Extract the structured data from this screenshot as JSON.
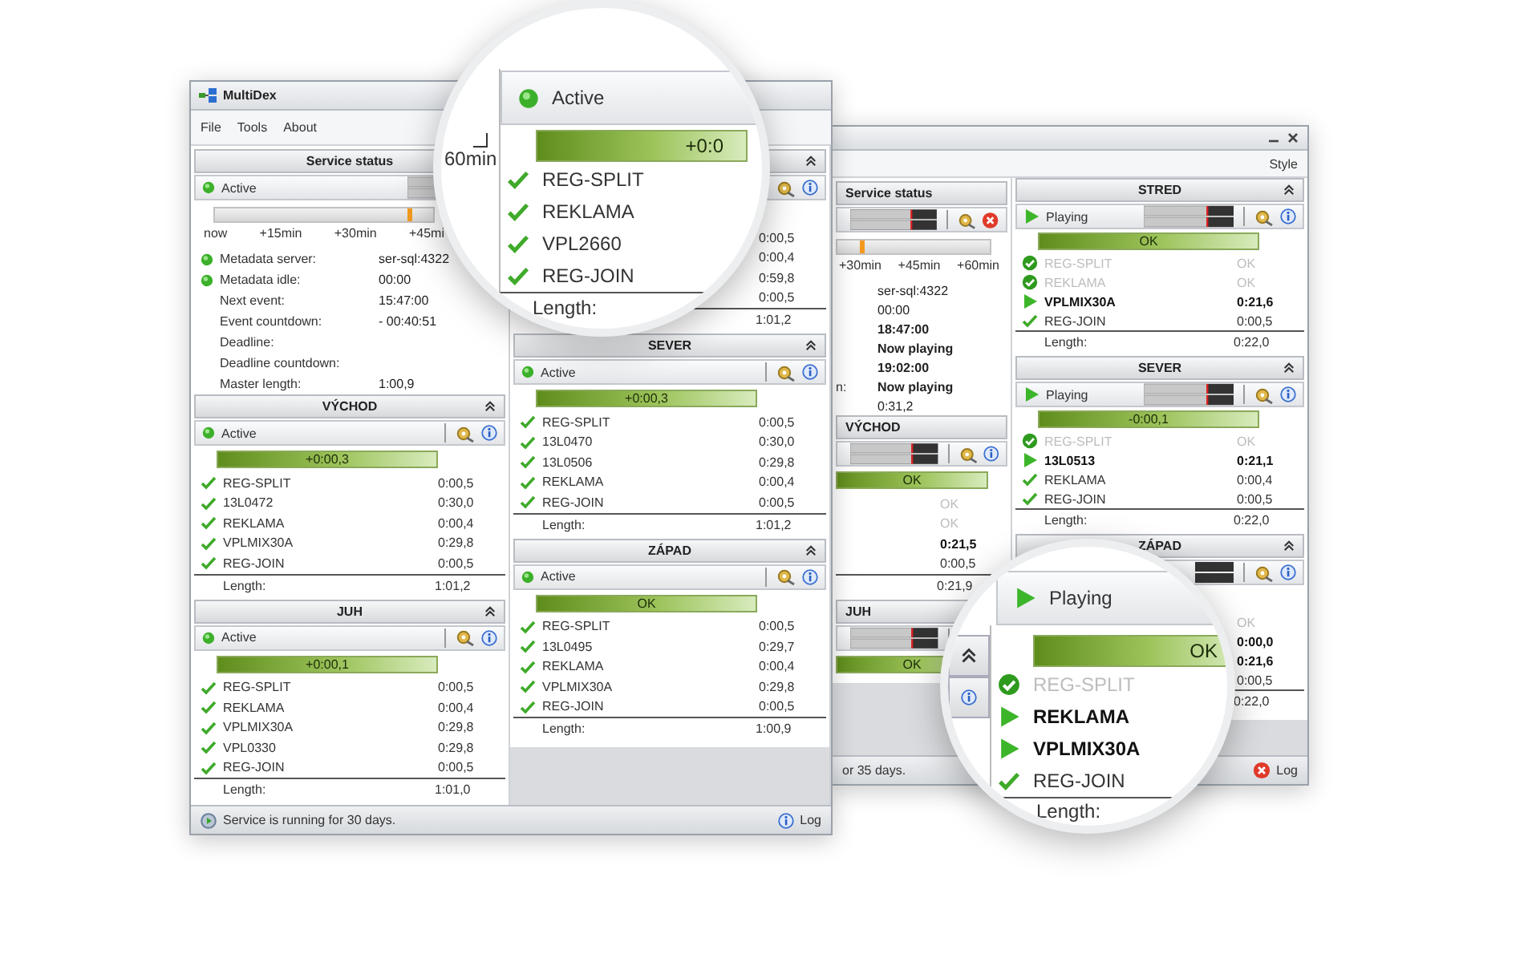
{
  "front_window": {
    "title": "MultiDex",
    "menu": [
      "File",
      "Tools",
      "About"
    ],
    "service": {
      "header": "Service status",
      "status": "Active",
      "kind": "active",
      "timeline": [
        "now",
        "+15min",
        "+30min",
        "+45mi"
      ],
      "info": [
        {
          "label": "Metadata server:",
          "value": "ser-sql:4322",
          "dot": true
        },
        {
          "label": "Metadata idle:",
          "value": "00:00",
          "dot": true
        },
        {
          "label": "Next event:",
          "value": "15:47:00",
          "dot": false
        },
        {
          "label": "Event countdown:",
          "value": "- 00:40:51",
          "dot": false
        },
        {
          "label": "Deadline:",
          "dot": false
        },
        {
          "label": "Deadline countdown:",
          "dot": false
        },
        {
          "label": "Master length:",
          "value": "1:00,9",
          "dot": false
        }
      ]
    },
    "left_groups": [
      {
        "title": "VÝCHOD",
        "status": "Active",
        "kind": "active",
        "offset": "+0:00,3",
        "rows": [
          {
            "name": "REG-SPLIT",
            "time": "0:00,5",
            "kind": "check"
          },
          {
            "name": "13L0472",
            "time": "0:30,0",
            "kind": "check"
          },
          {
            "name": "REKLAMA",
            "time": "0:00,4",
            "kind": "check"
          },
          {
            "name": "VPLMIX30A",
            "time": "0:29,8",
            "kind": "check"
          },
          {
            "name": "REG-JOIN",
            "time": "0:00,5",
            "kind": "check"
          }
        ],
        "length_label": "Length:",
        "length": "1:01,2"
      },
      {
        "title": "JUH",
        "status": "Active",
        "kind": "active",
        "offset": "+0:00,1",
        "rows": [
          {
            "name": "REG-SPLIT",
            "time": "0:00,5",
            "kind": "check"
          },
          {
            "name": "REKLAMA",
            "time": "0:00,4",
            "kind": "check"
          },
          {
            "name": "VPLMIX30A",
            "time": "0:29,8",
            "kind": "check"
          },
          {
            "name": "VPL0330",
            "time": "0:29,8",
            "kind": "check"
          },
          {
            "name": "REG-JOIN",
            "time": "0:00,5",
            "kind": "check"
          }
        ],
        "length_label": "Length:",
        "length": "1:01,0"
      }
    ],
    "right_groups": [
      {
        "rows": [
          {
            "time": "0:00,5",
            "kind": "check"
          },
          {
            "time": "0:00,4",
            "kind": "check"
          },
          {
            "time": "0:59,8",
            "kind": "check"
          },
          {
            "time": "0:00,5",
            "kind": "check"
          }
        ],
        "length": "1:01,2"
      },
      {
        "title": "SEVER",
        "status": "Active",
        "kind": "active",
        "offset": "+0:00,3",
        "rows": [
          {
            "name": "REG-SPLIT",
            "time": "0:00,5",
            "kind": "check"
          },
          {
            "name": "13L0470",
            "time": "0:30,0",
            "kind": "check"
          },
          {
            "name": "13L0506",
            "time": "0:29,8",
            "kind": "check"
          },
          {
            "name": "REKLAMA",
            "time": "0:00,4",
            "kind": "check"
          },
          {
            "name": "REG-JOIN",
            "time": "0:00,5",
            "kind": "check"
          }
        ],
        "length_label": "Length:",
        "length": "1:01,2"
      },
      {
        "title": "ZÁPAD",
        "status": "Active",
        "kind": "active",
        "offset": "OK",
        "rows": [
          {
            "name": "REG-SPLIT",
            "time": "0:00,5",
            "kind": "check"
          },
          {
            "name": "13L0495",
            "time": "0:29,7",
            "kind": "check"
          },
          {
            "name": "REKLAMA",
            "time": "0:00,4",
            "kind": "check"
          },
          {
            "name": "VPLMIX30A",
            "time": "0:29,8",
            "kind": "check"
          },
          {
            "name": "REG-JOIN",
            "time": "0:00,5",
            "kind": "check"
          }
        ],
        "length_label": "Length:",
        "length": "1:00,9"
      }
    ],
    "status_bar": {
      "text": "Service is running for 30 days.",
      "log": "Log"
    }
  },
  "back_window": {
    "menu": [
      "Style"
    ],
    "service": {
      "header": "Service status",
      "timeline": [
        "+30min",
        "+45min",
        "+60min"
      ],
      "info": [
        {
          "value": "ser-sql:4322",
          "bold": false
        },
        {
          "value": "00:00",
          "bold": false
        },
        {
          "value": "18:47:00",
          "bold": true
        },
        {
          "value": "Now playing",
          "bold": true
        },
        {
          "value": "19:02:00",
          "bold": true
        },
        {
          "label": "n:",
          "value": "Now playing",
          "bold": true
        },
        {
          "value": "0:31,2",
          "bold": false
        }
      ]
    },
    "left_groups": [
      {
        "title": "VÝCHOD",
        "offset": "OK",
        "rows": [
          {
            "time": "OK",
            "kind": "done"
          },
          {
            "time": "OK",
            "kind": "done"
          },
          {
            "time": "0:21,5",
            "kind": "playing"
          },
          {
            "time": "0:00,5",
            "kind": "check"
          }
        ],
        "length": "0:21,9"
      },
      {
        "title": "JUH",
        "offset": "OK"
      }
    ],
    "right_groups": [
      {
        "title": "STRED",
        "status": "Playing",
        "kind": "playing",
        "offset": "OK",
        "rows": [
          {
            "name": "REG-SPLIT",
            "time": "OK",
            "kind": "done"
          },
          {
            "name": "REKLAMA",
            "time": "OK",
            "kind": "done"
          },
          {
            "name": "VPLMIX30A",
            "time": "0:21,6",
            "kind": "playing"
          },
          {
            "name": "REG-JOIN",
            "time": "0:00,5",
            "kind": "check"
          }
        ],
        "length_label": "Length:",
        "length": "0:22,0"
      },
      {
        "title": "SEVER",
        "status": "Playing",
        "kind": "playing",
        "offset": "-0:00,1",
        "rows": [
          {
            "name": "REG-SPLIT",
            "time": "OK",
            "kind": "done"
          },
          {
            "name": "13L0513",
            "time": "0:21,1",
            "kind": "playing"
          },
          {
            "name": "REKLAMA",
            "time": "0:00,4",
            "kind": "check"
          },
          {
            "name": "REG-JOIN",
            "time": "0:00,5",
            "kind": "check"
          }
        ],
        "length_label": "Length:",
        "length": "0:22,0"
      },
      {
        "title": "ZÁPAD",
        "rows": [
          {
            "time": "OK",
            "kind": "done"
          },
          {
            "time": "0:00,0",
            "kind": "playing"
          },
          {
            "time": "0:21,6",
            "kind": "playing"
          },
          {
            "time": "0:00,5",
            "kind": "check"
          }
        ],
        "length": "0:22,0"
      }
    ],
    "status_bar": {
      "text": "or 35 days.",
      "log": "Log"
    }
  },
  "magnifier_top": {
    "scale_label": "60min",
    "status": "Active",
    "kind": "active",
    "offset": "+0:0",
    "rows": [
      {
        "name": "REG-SPLIT",
        "kind": "check"
      },
      {
        "name": "REKLAMA",
        "kind": "check"
      },
      {
        "name": "VPL2660",
        "kind": "check"
      },
      {
        "name": "REG-JOIN",
        "kind": "check"
      }
    ],
    "length_label": "Length:"
  },
  "magnifier_bottom": {
    "status": "Playing",
    "kind": "playing",
    "offset": "OK",
    "rows": [
      {
        "name": "REG-SPLIT",
        "kind": "done"
      },
      {
        "name": "REKLAMA",
        "kind": "playing"
      },
      {
        "name": "VPLMIX30A",
        "kind": "playing"
      },
      {
        "name": "REG-JOIN",
        "kind": "check"
      }
    ],
    "length_label": "Length:"
  }
}
